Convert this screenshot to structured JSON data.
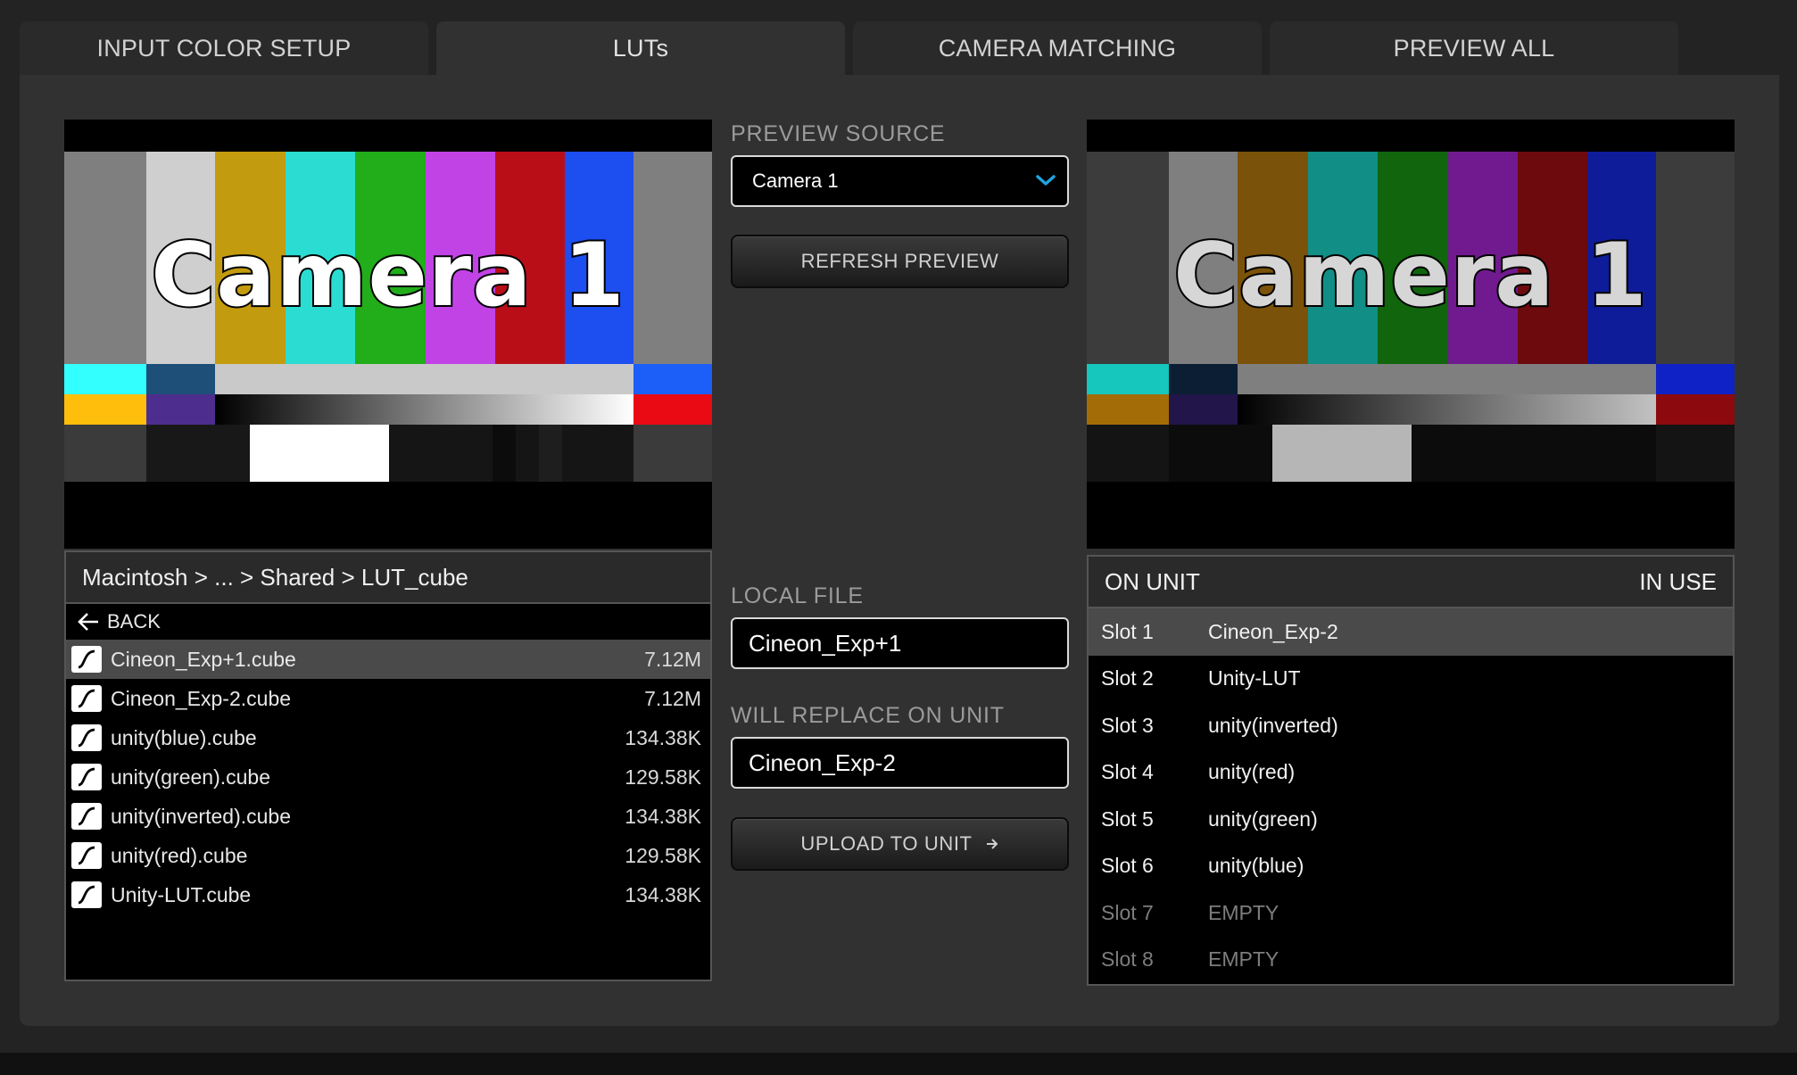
{
  "tabs": [
    {
      "label": "INPUT COLOR SETUP",
      "active": false
    },
    {
      "label": "LUTs",
      "active": true
    },
    {
      "label": "CAMERA MATCHING",
      "active": false
    },
    {
      "label": "PREVIEW ALL",
      "active": false
    }
  ],
  "preview": {
    "left_label": "Camera 1",
    "right_label": "Camera 1"
  },
  "preview_source": {
    "label": "PREVIEW SOURCE",
    "value": "Camera 1",
    "refresh_label": "REFRESH PREVIEW"
  },
  "local_file": {
    "label": "LOCAL FILE",
    "value": "Cineon_Exp+1"
  },
  "will_replace": {
    "label": "WILL REPLACE ON UNIT",
    "value": "Cineon_Exp-2"
  },
  "upload_label": "UPLOAD TO UNIT",
  "browser": {
    "path": "Macintosh > ... > Shared > LUT_cube",
    "back_label": "BACK",
    "files": [
      {
        "name": "Cineon_Exp+1.cube",
        "size": "7.12M",
        "selected": true
      },
      {
        "name": "Cineon_Exp-2.cube",
        "size": "7.12M",
        "selected": false
      },
      {
        "name": "unity(blue).cube",
        "size": "134.38K",
        "selected": false
      },
      {
        "name": "unity(green).cube",
        "size": "129.58K",
        "selected": false
      },
      {
        "name": "unity(inverted).cube",
        "size": "134.38K",
        "selected": false
      },
      {
        "name": "unity(red).cube",
        "size": "129.58K",
        "selected": false
      },
      {
        "name": "Unity-LUT.cube",
        "size": "134.38K",
        "selected": false
      }
    ]
  },
  "unit": {
    "header_left": "ON UNIT",
    "header_right": "IN USE",
    "slots": [
      {
        "slot": "Slot 1",
        "lut": "Cineon_Exp-2",
        "selected": true,
        "empty": false
      },
      {
        "slot": "Slot 2",
        "lut": "Unity-LUT",
        "selected": false,
        "empty": false
      },
      {
        "slot": "Slot 3",
        "lut": "unity(inverted)",
        "selected": false,
        "empty": false
      },
      {
        "slot": "Slot 4",
        "lut": "unity(red)",
        "selected": false,
        "empty": false
      },
      {
        "slot": "Slot 5",
        "lut": "unity(green)",
        "selected": false,
        "empty": false
      },
      {
        "slot": "Slot 6",
        "lut": "unity(blue)",
        "selected": false,
        "empty": false
      },
      {
        "slot": "Slot 7",
        "lut": "EMPTY",
        "selected": false,
        "empty": true
      },
      {
        "slot": "Slot 8",
        "lut": "EMPTY",
        "selected": false,
        "empty": true
      }
    ]
  },
  "colors": {
    "accent": "#1fa3e0",
    "panel": "#313131",
    "background": "#232323"
  }
}
